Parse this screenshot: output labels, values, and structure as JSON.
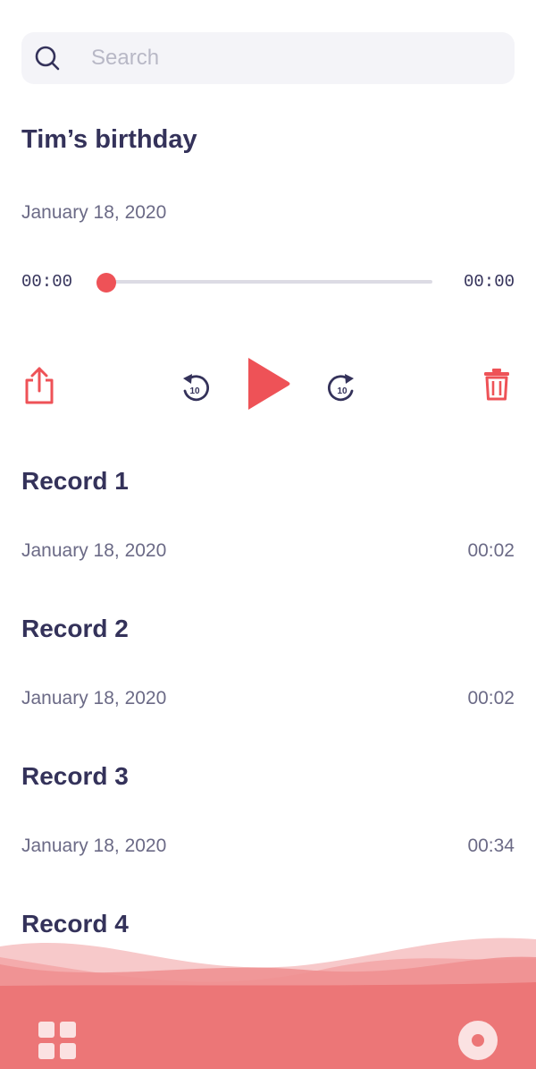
{
  "search": {
    "placeholder": "Search"
  },
  "player": {
    "title": "Tim’s birthday",
    "date": "January 18, 2020",
    "elapsed": "00:00",
    "total": "00:00",
    "progress": 0.0,
    "skip_back_seconds": "10",
    "skip_forward_seconds": "10"
  },
  "records": [
    {
      "title": "Record 1",
      "date": "January 18, 2020",
      "duration": "00:02"
    },
    {
      "title": "Record 2",
      "date": "January 18, 2020",
      "duration": "00:02"
    },
    {
      "title": "Record 3",
      "date": "January 18, 2020",
      "duration": "00:34"
    },
    {
      "title": "Record 4",
      "date": "",
      "duration": ""
    }
  ],
  "colors": {
    "accent": "#ee5257",
    "text": "#34325a",
    "muted": "#6b6a86",
    "wave": "#ec7677"
  },
  "icons": {
    "search": "search-icon",
    "share": "share-icon",
    "rewind": "rewind-10-icon",
    "play": "play-icon",
    "forward": "forward-10-icon",
    "delete": "trash-icon",
    "grid": "grid-icon",
    "record": "record-icon"
  }
}
